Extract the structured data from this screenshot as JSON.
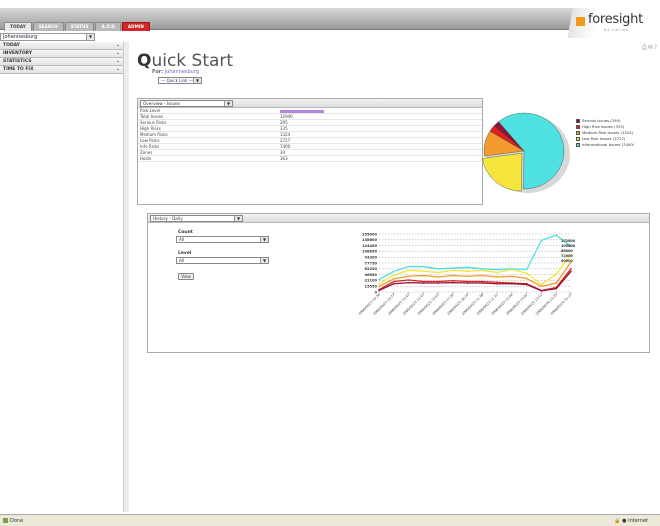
{
  "tabs": [
    {
      "label": "TODAY",
      "active": true
    },
    {
      "label": "SEARCH"
    },
    {
      "label": "STATUS"
    },
    {
      "label": "A.O.D"
    },
    {
      "label": "ADMIN",
      "highlight": true
    }
  ],
  "logo": {
    "text": "foresight",
    "sub": "by cairos"
  },
  "location": {
    "value": "Johannesburg"
  },
  "sidebar": {
    "items": [
      {
        "label": "TODAY"
      },
      {
        "label": "INVENTORY"
      },
      {
        "label": "STATISTICS"
      },
      {
        "label": "TIME TO FIX"
      }
    ]
  },
  "page": {
    "title_first": "Q",
    "title_rest": "uick Start",
    "for_label": "For:",
    "for_value": "Johannesburg",
    "quick_link": "--- Quick Link ---"
  },
  "overview": {
    "selector": "Overview - Issues",
    "rows": [
      {
        "label": "Risk Level",
        "value": ""
      },
      {
        "label": "Total Issues",
        "value": "12940"
      },
      {
        "label": "Serious Risks",
        "value": "295"
      },
      {
        "label": "High Risks",
        "value": "335"
      },
      {
        "label": "Medium Risks",
        "value": "1324"
      },
      {
        "label": "Low Risks",
        "value": "2727"
      },
      {
        "label": "Info Risks",
        "value": "7400"
      },
      {
        "label": "Zones",
        "value": "34"
      },
      {
        "label": "Hosts",
        "value": "363"
      }
    ]
  },
  "pie": {
    "legend": [
      {
        "label": "Serious Issues (295)",
        "color": "#8a1538"
      },
      {
        "label": "High Risk Issues (335)",
        "color": "#e02020"
      },
      {
        "label": "Medium Risk Issues (1324)",
        "color": "#f29a2e"
      },
      {
        "label": "Low Risk Issues (2727)",
        "color": "#f5e53d"
      },
      {
        "label": "Informational Issues (7400)",
        "color": "#4fe0e0"
      }
    ]
  },
  "history": {
    "selector": "History - Daily",
    "count_label": "Count",
    "count_value": "All",
    "level_label": "Level",
    "level_value": "All",
    "view_label": "View"
  },
  "chart_data": {
    "type": "line",
    "categories": [
      "2006/04/23 10:20",
      "2006/04/23 10:27",
      "2006/04/23 13:47",
      "2006/04/23 13:47",
      "2006/04/23 13:55",
      "2006/04/23 17:22",
      "2006/04/23 18:14",
      "2006/04/23 11:38",
      "2006/04/23 11:31",
      "2006/04/23 12:04",
      "2006/04/23 13:01",
      "2006/04/23 13:51",
      "2006/04/30 13:23",
      "2006/05/10 15:17"
    ],
    "y_ticks": [
      "155000",
      "138600",
      "124400",
      "108850",
      "93300",
      "77750",
      "62200",
      "46650",
      "31100",
      "15550",
      "0"
    ],
    "ylim": [
      0,
      155000
    ],
    "series": [
      {
        "color": "#4fe0e0",
        "values": [
          33000,
          55000,
          68000,
          68000,
          62000,
          64000,
          66000,
          62000,
          60000,
          62000,
          60000,
          138000,
          152000,
          122000
        ]
      },
      {
        "color": "#f5e53d",
        "values": [
          22000,
          45000,
          58000,
          56000,
          52000,
          58000,
          55000,
          58000,
          52000,
          60000,
          50000,
          20000,
          48000,
          100000
        ]
      },
      {
        "color": "#f29a2e",
        "values": [
          15000,
          35000,
          42000,
          44000,
          40000,
          44000,
          42000,
          44000,
          40000,
          42000,
          36000,
          15000,
          24000,
          80000
        ]
      },
      {
        "color": "#e02020",
        "values": [
          6000,
          28000,
          32000,
          28000,
          28000,
          30000,
          28000,
          28000,
          26000,
          24000,
          22000,
          4000,
          12000,
          62000
        ]
      },
      {
        "color": "#8a1538",
        "values": [
          4000,
          22000,
          25000,
          24000,
          24000,
          25000,
          24000,
          24000,
          22000,
          22000,
          20000,
          3000,
          9000,
          55000
        ]
      }
    ],
    "end_labels": [
      "122600",
      "105800",
      "86000",
      "72000",
      "60000"
    ],
    "grid": true
  },
  "status": {
    "left": "Done",
    "right": "Internet"
  }
}
